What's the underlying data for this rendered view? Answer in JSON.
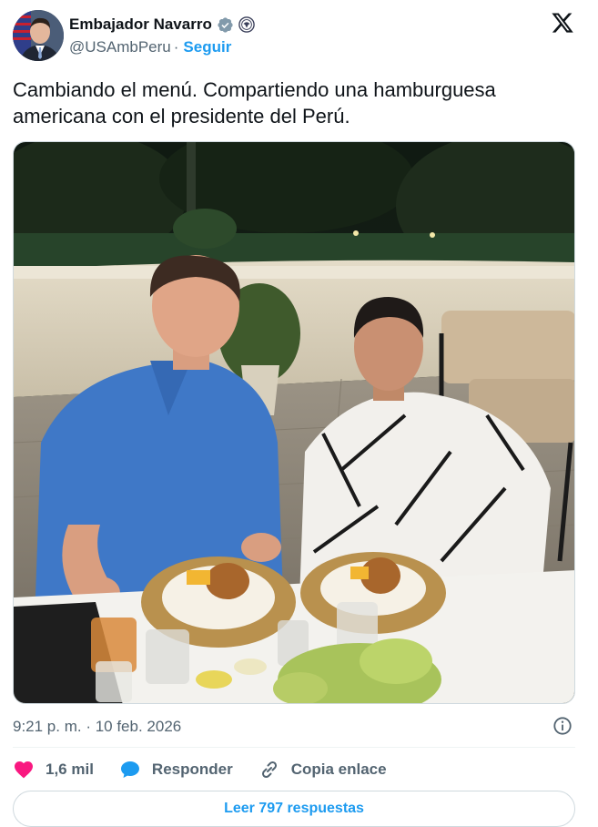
{
  "author": {
    "name": "Embajador Navarro",
    "handle": "@USAmbPeru",
    "separator": "·",
    "follow_label": "Seguir"
  },
  "tweet": {
    "text": "Cambiando el menú. Compartiendo una hamburguesa americana con el presidente del Perú.",
    "timestamp": "9:21 p. m. · 10 feb. 2026"
  },
  "stats": {
    "likes": "1,6 mil",
    "reply_label": "Responder",
    "copy_link_label": "Copia enlace"
  },
  "read_replies_label": "Leer 797 respuestas",
  "icons": {
    "verified": "verified-badge-icon",
    "seal": "government-seal-icon",
    "logo": "x-logo-icon",
    "info": "info-icon",
    "like": "heart-icon",
    "reply": "speech-bubble-icon",
    "link": "link-icon"
  },
  "colors": {
    "accent": "#1d9bf0",
    "like": "#f91880",
    "muted": "#536471"
  }
}
